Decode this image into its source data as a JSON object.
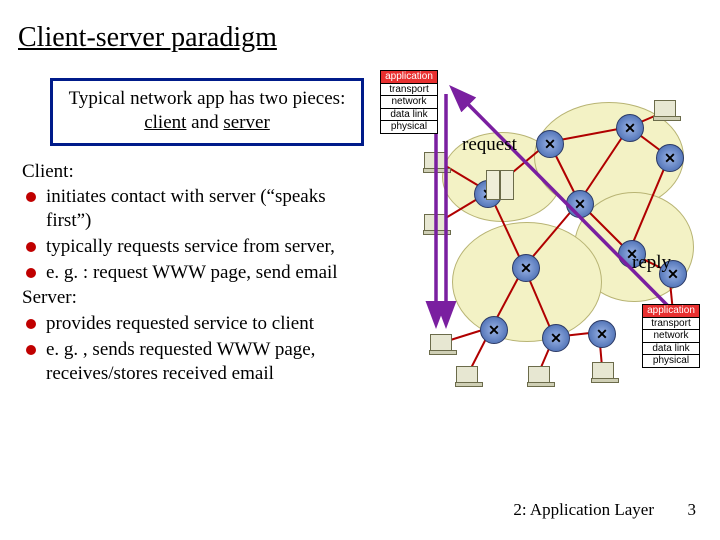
{
  "title": "Client-server paradigm",
  "subtitle": {
    "prefix": "Typical network app has two pieces: ",
    "client_word": "client",
    "and_word": " and ",
    "server_word": "server"
  },
  "client": {
    "heading": "Client:",
    "items": [
      "initiates contact with server (“speaks first”)",
      "typically requests service from server,",
      "e. g. : request WWW page, send email"
    ]
  },
  "server": {
    "heading": "Server:",
    "items": [
      "provides requested service to client",
      "e. g. , sends requested WWW page, receives/stores received email"
    ]
  },
  "stack_layers": [
    "application",
    "transport",
    "network",
    "data link",
    "physical"
  ],
  "labels": {
    "request": "request",
    "reply": "reply"
  },
  "footer": {
    "chapter": "2: Application Layer",
    "page": "3"
  }
}
